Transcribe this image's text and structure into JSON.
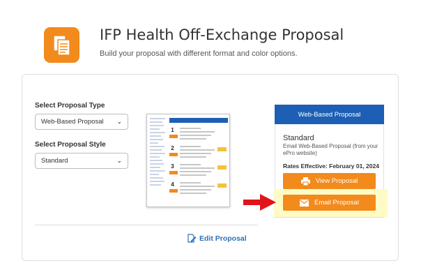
{
  "header": {
    "icon": "document-copy-icon",
    "title": "IFP Health Off-Exchange Proposal",
    "subtitle": "Build your proposal with different format and color options."
  },
  "form": {
    "type_label": "Select Proposal Type",
    "type_value": "Web-Based Proposal",
    "style_label": "Select Proposal Style",
    "style_value": "Standard"
  },
  "panel": {
    "heading": "Web-Based Proposal",
    "style_name": "Standard",
    "description": "Email Web-Based Proposal (from your ePro website)",
    "rates": "Rates Effective: February 01, 2024",
    "view_label": "View Proposal",
    "email_label": "Email Proposal"
  },
  "edit_label": "Edit Proposal",
  "colors": {
    "accent_orange": "#f28a1c",
    "header_blue": "#1c5fb5",
    "link_blue": "#2f6fb5",
    "arrow_red": "#e0151b",
    "highlight_yellow": "#fffbc6"
  }
}
